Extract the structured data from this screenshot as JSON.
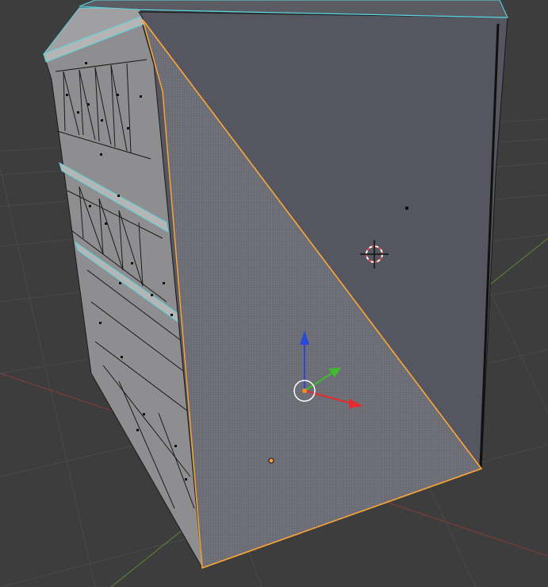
{
  "viewport": {
    "background_color": "#3d3d3d",
    "grid_color": "#4b4b4b",
    "x_axis_color": "#8a3a3a",
    "y_axis_color": "#5e8a2e"
  },
  "mesh": {
    "face_color": "#55565f",
    "side_face_color": "#8d8d8f",
    "selected_face_color": "#6a6b73",
    "selected_edge_color": "#f7a43b",
    "seam_edge_color": "#5ad6e0",
    "wire_color": "#1a1a1a"
  },
  "cursor_3d": {
    "icon": "3d-cursor-icon",
    "ring_colors": [
      "#e64a4a",
      "#ffffff"
    ]
  },
  "transform_gizmo": {
    "x_color": "#e52b2b",
    "y_color": "#3dbd2d",
    "z_color": "#2b49d9",
    "origin_color": "#f58b24"
  }
}
